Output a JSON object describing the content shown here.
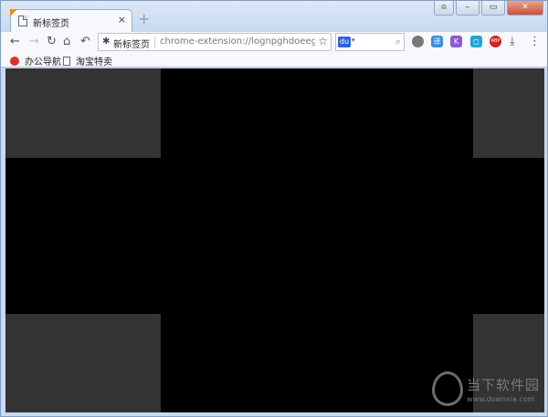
{
  "tab": {
    "title": "新标签页",
    "close": "×",
    "new_tab": "+"
  },
  "window_controls": {
    "user": "⍝",
    "minimize": "–",
    "restore": "▭",
    "close": "✕"
  },
  "toolbar": {
    "back": "←",
    "forward": "→",
    "reload": "↻",
    "home": "⌂",
    "undo": "↶",
    "omnibox": {
      "page_label": "新标签页",
      "url": "chrome-extension://lognpghdoeeg...",
      "star": "☆"
    },
    "search": {
      "engine_icon": "baidu-paw-icon",
      "engine_glyph": "du",
      "caret": "▾",
      "magnifier": "⌕"
    },
    "extensions": [
      {
        "name": "ext-gray-round-icon",
        "color": "#777777",
        "glyph": ""
      },
      {
        "name": "ext-translate-icon",
        "color": "#3a8ee6",
        "glyph": "译"
      },
      {
        "name": "ext-purple-icon",
        "color": "#8b5ad6",
        "glyph": "K"
      },
      {
        "name": "ext-screenshot-icon",
        "color": "#1fa3d8",
        "glyph": "◻"
      },
      {
        "name": "ext-adblock-icon",
        "color": "#d8201f",
        "glyph": "ABP"
      }
    ],
    "download": "⤓",
    "menu": "⋮"
  },
  "bookmarks": [
    {
      "label": "办公导航",
      "icon": "red-circle-icon"
    },
    {
      "label": "淘宝特卖",
      "icon": "page-icon"
    }
  ],
  "content": {
    "background": "#000000",
    "tile_color": "#333333",
    "tile_count": 4
  },
  "watermark": {
    "name": "当下软件园",
    "url": "www.downxia.com"
  }
}
